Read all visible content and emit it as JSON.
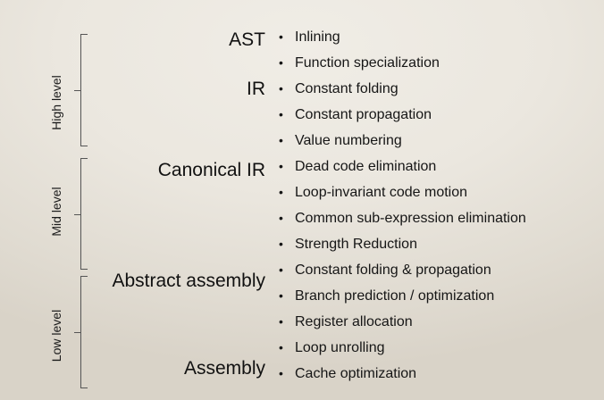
{
  "levels": [
    {
      "label": "High level"
    },
    {
      "label": "Mid level"
    },
    {
      "label": "Low level"
    }
  ],
  "stages": [
    {
      "label": "AST"
    },
    {
      "label": "IR"
    },
    {
      "label": "Canonical IR"
    },
    {
      "label": "Abstract assembly"
    },
    {
      "label": "Assembly"
    }
  ],
  "bullet": "•",
  "optimizations": [
    "Inlining",
    "Function specialization",
    "Constant folding",
    "Constant propagation",
    "Value numbering",
    "Dead code elimination",
    "Loop-invariant code motion",
    "Common sub-expression elimination",
    "Strength Reduction",
    "Constant folding & propagation",
    "Branch prediction / optimization",
    "Register allocation",
    "Loop unrolling",
    "Cache optimization"
  ]
}
